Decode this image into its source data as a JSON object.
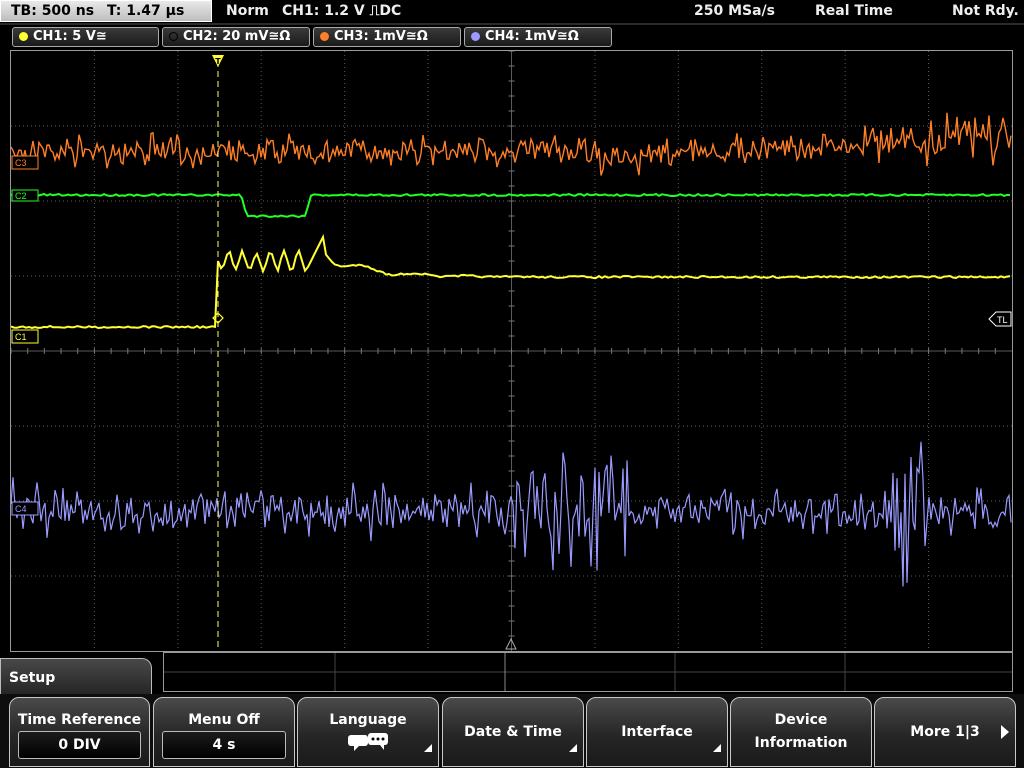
{
  "status": {
    "timebase": "TB: 500 ns",
    "trigger_time": "T: 1.47 µs",
    "mode": "Norm",
    "trigger": "CH1: 1.2 V ⎍DC",
    "sample_rate": "250 MSa/s",
    "acq_mode": "Real Time",
    "state": "Not Rdy."
  },
  "channels": [
    {
      "label": "CH1: 5 V≅",
      "color": "#ffff33",
      "active": false
    },
    {
      "label": "CH2: 20 mV≅Ω",
      "color": "#22ff22",
      "active": true
    },
    {
      "label": "CH3: 1mV≅Ω",
      "color": "#ff7f27",
      "active": false
    },
    {
      "label": "CH4: 1mV≅Ω",
      "color": "#9a9aff",
      "active": false
    }
  ],
  "markers": {
    "ch1": "C1",
    "ch2": "C2",
    "ch3": "C3",
    "ch4": "C4",
    "trigger_level": "TL",
    "trigger_pos": "T"
  },
  "menu": {
    "tab": "Setup",
    "time_reference": {
      "label": "Time Reference",
      "value": "0 DIV"
    },
    "menu_off": {
      "label": "Menu Off",
      "value": "4 s"
    },
    "language": {
      "label": "Language"
    },
    "date_time": {
      "label": "Date & Time"
    },
    "interface": {
      "label": "Interface"
    },
    "device_info": {
      "line1": "Device",
      "line2": "Information"
    },
    "more": {
      "label": "More 1|3"
    }
  },
  "colors": {
    "ch1": "#ffff33",
    "ch2": "#22ff22",
    "ch3": "#ff7f27",
    "ch4": "#9a9aff",
    "grid": "#5a5a5a"
  }
}
